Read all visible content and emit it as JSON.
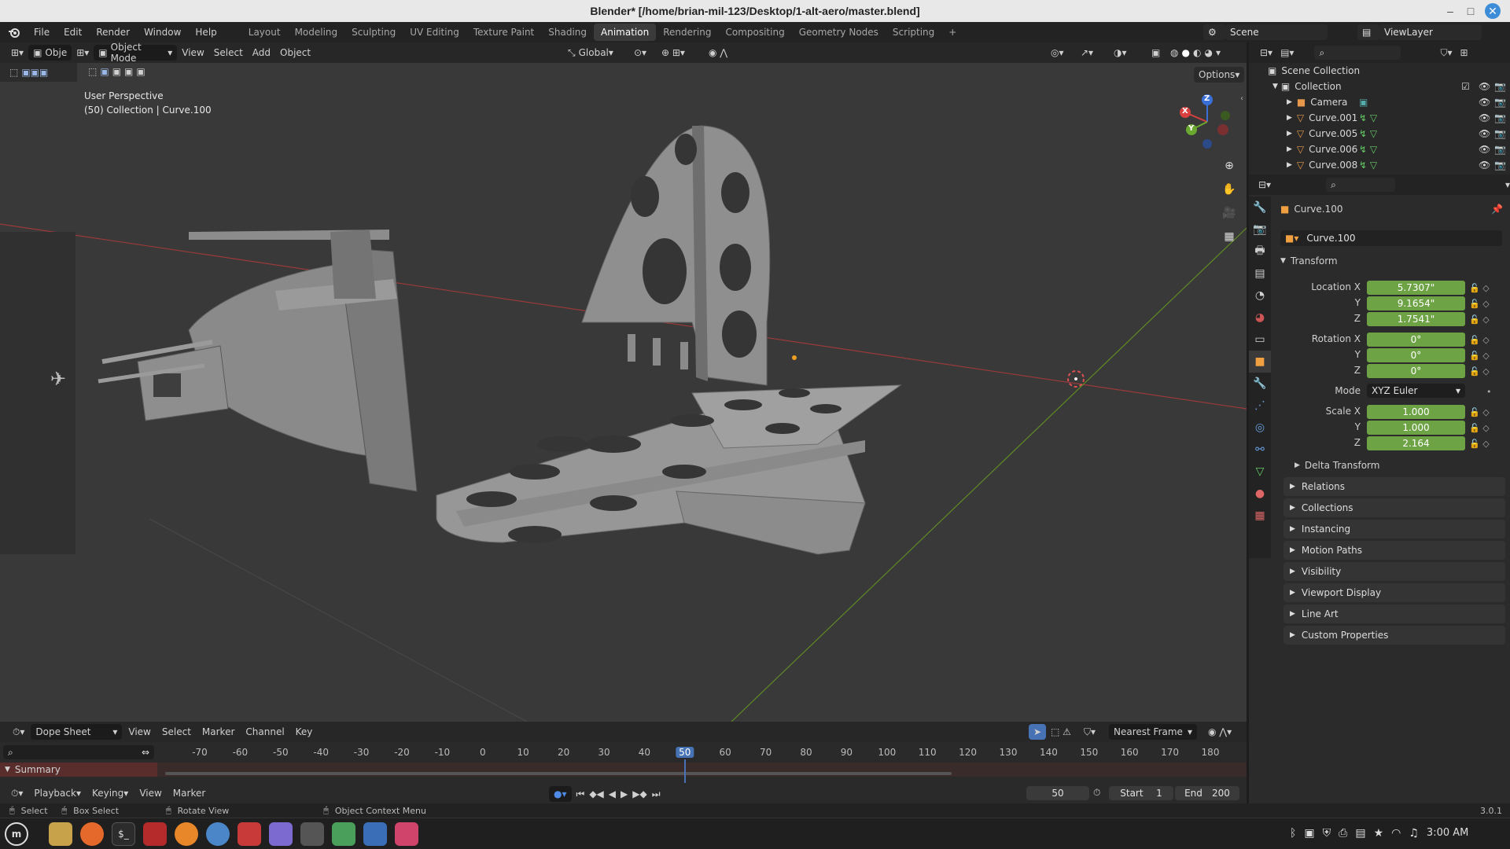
{
  "window": {
    "title": "Blender* [/home/brian-mil-123/Desktop/1-alt-aero/master.blend]"
  },
  "menus": [
    "File",
    "Edit",
    "Render",
    "Window",
    "Help"
  ],
  "workspaces": [
    "Layout",
    "Modeling",
    "Sculpting",
    "UV Editing",
    "Texture Paint",
    "Shading",
    "Animation",
    "Rendering",
    "Compositing",
    "Geometry Nodes",
    "Scripting"
  ],
  "active_workspace": "Animation",
  "scene": "Scene",
  "view_layer": "ViewLayer",
  "viewport": {
    "mode_left": "Obje",
    "mode": "Object Mode",
    "menus": [
      "View",
      "Select",
      "Add",
      "Object"
    ],
    "orientation": "Global",
    "options": "Options",
    "info_line1": "User Perspective",
    "info_line2": "(50) Collection | Curve.100",
    "gizmo": {
      "x": "X",
      "y": "Y",
      "z": "Z"
    }
  },
  "outliner": {
    "root": "Scene Collection",
    "collection": "Collection",
    "items": [
      "Camera",
      "Curve.001",
      "Curve.005",
      "Curve.006",
      "Curve.008"
    ]
  },
  "properties": {
    "object_name": "Curve.100",
    "data_name": "Curve.100",
    "transform_header": "Transform",
    "location_label": "Location X",
    "rotation_label": "Rotation X",
    "scale_label": "Scale X",
    "y": "Y",
    "z": "Z",
    "location": [
      "5.7307\"",
      "9.1654\"",
      "1.7541\""
    ],
    "rotation": [
      "0°",
      "0°",
      "0°"
    ],
    "mode_label": "Mode",
    "mode": "XYZ Euler",
    "scale": [
      "1.000",
      "1.000",
      "2.164"
    ],
    "delta": "Delta Transform",
    "panels": [
      "Relations",
      "Collections",
      "Instancing",
      "Motion Paths",
      "Visibility",
      "Viewport Display",
      "Line Art",
      "Custom Properties"
    ]
  },
  "dopesheet": {
    "editor": "Dope Sheet",
    "menus": [
      "View",
      "Select",
      "Marker",
      "Channel",
      "Key"
    ],
    "snap": "Nearest Frame",
    "summary": "Summary",
    "ticks": [
      "-70",
      "-60",
      "-50",
      "-40",
      "-30",
      "-20",
      "-10",
      "0",
      "10",
      "20",
      "30",
      "40",
      "50",
      "60",
      "70",
      "80",
      "90",
      "100",
      "110",
      "120",
      "130",
      "140",
      "150",
      "160",
      "170",
      "180"
    ],
    "current_frame": "50"
  },
  "timeline": {
    "menus": [
      "Playback",
      "Keying",
      "View",
      "Marker"
    ],
    "frame": "50",
    "start_label": "Start",
    "start": "1",
    "end_label": "End",
    "end": "200"
  },
  "statusbar": {
    "items": [
      "Select",
      "Box Select",
      "Rotate View",
      "Object Context Menu"
    ],
    "version": "3.0.1"
  },
  "taskbar": {
    "time": "3:00 AM"
  },
  "colors": {
    "accent": "#4772b3",
    "field_green": "#6da345",
    "x_axis": "#b33b3b",
    "y_axis": "#6b9a2a",
    "summary": "#5a2d2d"
  }
}
